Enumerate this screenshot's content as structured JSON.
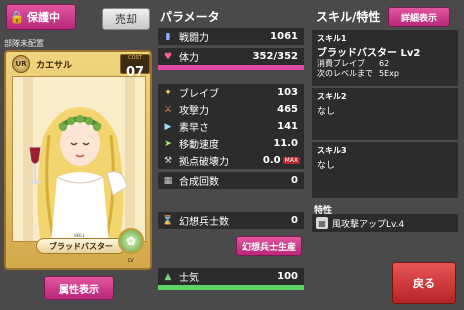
{
  "header": {
    "protect_label": "保護中",
    "sell_label": "売却"
  },
  "card": {
    "assignment": "部隊未配置",
    "rarity": "UR",
    "name": "カエサル",
    "cost_label": "COST",
    "cost": "07",
    "skill_label": "ブラッドバスター",
    "skill_tag": "SKILL",
    "lv_tag": "LV"
  },
  "attr_button": "属性表示",
  "params": {
    "title": "パラメータ",
    "combat": {
      "label": "戦闘力",
      "value": "1061"
    },
    "hp": {
      "label": "体力",
      "value": "352/352",
      "fraction": 1.0
    },
    "stats": [
      {
        "label": "ブレイブ",
        "value": "103"
      },
      {
        "label": "攻撃力",
        "value": "465"
      },
      {
        "label": "素早さ",
        "value": "141"
      },
      {
        "label": "移動速度",
        "value": "11.0"
      },
      {
        "label": "拠点破壊力",
        "value": "0.0",
        "badge": "MAX"
      }
    ],
    "combine": {
      "label": "合成回数",
      "value": "0"
    },
    "phantom": {
      "label": "幻想兵士数",
      "value": "0"
    },
    "phantom_button": "幻想兵士生産",
    "morale": {
      "label": "士気",
      "value": "100",
      "fraction": 1.0
    }
  },
  "skills": {
    "title": "スキル/特性",
    "detail_button": "詳細表示",
    "skill1": {
      "head": "スキル1",
      "name": "ブラッドバスター Lv2",
      "cost_label": "消費ブレイブ",
      "cost_value": "62",
      "next_label": "次のレベルまで",
      "next_value": "5Exp"
    },
    "skill2": {
      "head": "スキル2",
      "text": "なし"
    },
    "skill3": {
      "head": "スキル3",
      "text": "なし"
    },
    "trait_head": "特性",
    "trait": "風攻撃アップLv.4"
  },
  "back_button": "戻る",
  "colors": {
    "accent_pink": "#d23f8f",
    "hp_bar": "#e14aa2",
    "morale_bar": "#5fd36a",
    "back_red": "#cf3335"
  }
}
